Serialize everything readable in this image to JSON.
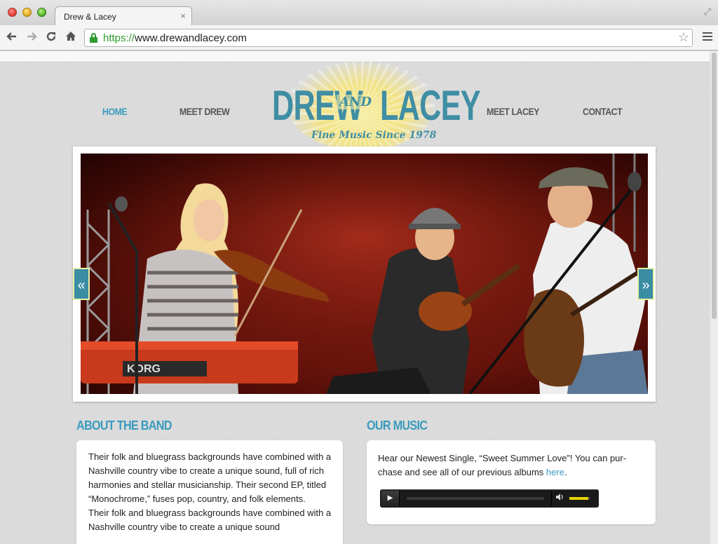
{
  "browser": {
    "tab_title": "Drew & Lacey",
    "tab_close": "×",
    "url_scheme": "https://",
    "url_rest": "www.drewandlacey.com",
    "icons": [
      "back-arrow-icon",
      "forward-arrow-icon",
      "reload-icon",
      "home-icon",
      "lock-icon",
      "star-icon",
      "menu-icon",
      "expand-icon"
    ]
  },
  "nav": {
    "home": "HOME",
    "meet_drew": "MEET DREW",
    "meet_lacey": "MEET LACEY",
    "contact": "CONTACT",
    "active": "home"
  },
  "logo": {
    "word1": "DREW",
    "word2": "AND",
    "word3": "LACEY",
    "tagline": "Fine Music Since 1978"
  },
  "slider": {
    "prev_label": "«",
    "next_label": "»"
  },
  "about": {
    "title": "ABOUT THE BAND",
    "paragraphs": [
      "Their folk and bluegrass backgrounds have combined with a Nashville country vibe to create a unique sound, full of rich harmonies and stellar musicianship. Their second EP, titled “Monochrome,” fuses pop, country, and folk elements.",
      "Their folk and bluegrass backgrounds have combined with a Nashville country vibe to create a unique sound"
    ]
  },
  "music": {
    "title": "OUR MUSIC",
    "text_before_link": "Hear our Newest Single, “Sweet Summer Love”! You can pur-chase and see all of our previous albums ",
    "link_text": "here",
    "text_after_link": ".",
    "player": {
      "play_icon": "▶",
      "volume_icon": "🔊",
      "progress": 0,
      "volume": 0.9
    }
  },
  "colors": {
    "accent": "#3a9bbd",
    "logo": "#3f8ea4",
    "sun": "#f2e387",
    "volume": "#e7d400"
  }
}
